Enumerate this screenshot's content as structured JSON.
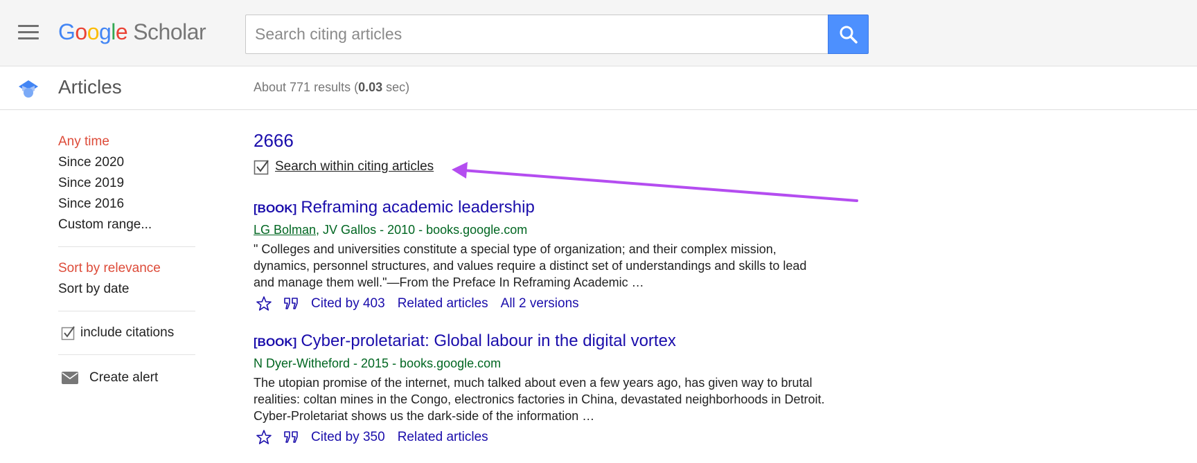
{
  "header": {
    "logo": {
      "letters": [
        "G",
        "o",
        "o",
        "g",
        "l",
        "e"
      ],
      "product": "Scholar"
    },
    "search": {
      "placeholder": "Search citing articles",
      "value": ""
    },
    "colors": {
      "search_button": "#4d90fe",
      "header_bg": "#f5f5f5"
    }
  },
  "subheader": {
    "section_label": "Articles",
    "results_prefix": "About 771 results (",
    "results_time": "0.03",
    "results_suffix": " sec)"
  },
  "sidebar": {
    "time_filters": [
      {
        "label": "Any time",
        "active": true
      },
      {
        "label": "Since 2020",
        "active": false
      },
      {
        "label": "Since 2019",
        "active": false
      },
      {
        "label": "Since 2016",
        "active": false
      },
      {
        "label": "Custom range...",
        "active": false
      }
    ],
    "sort_options": [
      {
        "label": "Sort by relevance",
        "active": true
      },
      {
        "label": "Sort by date",
        "active": false
      }
    ],
    "include_citations": {
      "label": "include citations",
      "checked": true
    },
    "create_alert": {
      "label": "Create alert"
    },
    "colors": {
      "active": "#dd4b39"
    }
  },
  "main": {
    "query_title": "2666",
    "search_within": {
      "label": "Search within citing articles",
      "checked": true
    },
    "results": [
      {
        "type": "[BOOK]",
        "title": "Reframing academic leadership",
        "author_link": "LG Bolman",
        "meta_rest": ", JV Gallos - 2010 - books.google.com",
        "snippet": "\" Colleges and universities constitute a special type of organization; and their complex mission, dynamics, personnel structures, and values require a distinct set of understandings and skills to lead and manage them well.\"—From the Preface In Reframing Academic …",
        "cited_by": "Cited by 403",
        "related": "Related articles",
        "versions": "All 2 versions"
      },
      {
        "type": "[BOOK]",
        "title": "Cyber-proletariat: Global labour in the digital vortex",
        "author_link": "",
        "meta_rest": "N Dyer-Witheford - 2015 - books.google.com",
        "snippet": "The utopian promise of the internet, much talked about even a few years ago, has given way to brutal realities: coltan mines in the Congo, electronics factories in China, devastated neighborhoods in Detroit. Cyber-Proletariat shows us the dark-side of the information …",
        "cited_by": "Cited by 350",
        "related": "Related articles",
        "versions": ""
      }
    ]
  },
  "annotation": {
    "arrow_color": "#b44df0",
    "icon": "arrow-pointer"
  }
}
